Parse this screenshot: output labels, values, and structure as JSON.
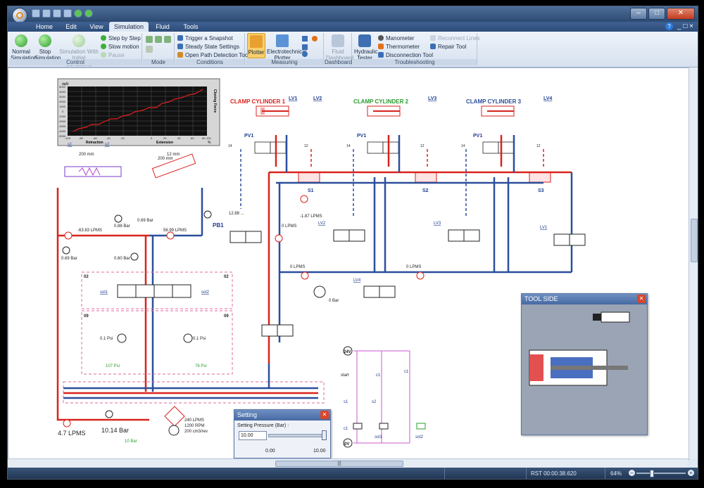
{
  "app": {
    "title": ""
  },
  "tabs": [
    "Home",
    "Edit",
    "View",
    "Simulation",
    "Fluid",
    "Tools"
  ],
  "active_tab": "Simulation",
  "ribbon": {
    "control": {
      "title": "Control",
      "normal_sim": "Normal Simulation",
      "stop_sim": "Stop Simulation",
      "sim_initial": "Simulation With Initial Conditions",
      "step_by_step": "Step by Step",
      "slow_motion": "Slow motion",
      "pause": "Pause"
    },
    "mode": {
      "title": "Mode"
    },
    "conditions": {
      "title": "Conditions",
      "trigger": "Trigger a Snapshot",
      "steady": "Steady State Settings",
      "open_path": "Open Path Detection Tool"
    },
    "measuring": {
      "title": "Measuring",
      "plotter": "Plotter",
      "electro": "Electrotechnical Plotter"
    },
    "dashboard": {
      "title": "Dashboard",
      "fluid": "Fluid Dashboard"
    },
    "troubleshooting": {
      "title": "Troubleshooting",
      "hydraulic": "Hydraulic Tester",
      "manometer": "Manometer",
      "thermometer": "Thermometer",
      "disconnection": "Disconnection Tool",
      "reconnect": "Reconnect Lines",
      "repair": "Repair Tool"
    }
  },
  "plot": {
    "yunit": "daN",
    "ylabel": "Closing Force",
    "left_label": "Retraction",
    "right_label": "Extension",
    "xunit": "%",
    "yticks": [
      "5000",
      "4000",
      "3000",
      "2000",
      "1000",
      "0",
      "-1000",
      "-2000",
      "-3000",
      "-4000",
      "-5000"
    ],
    "xticks": [
      "-100",
      "-80",
      "-60",
      "-40",
      "-20",
      "0",
      "20",
      "40",
      "60",
      "80",
      "100"
    ]
  },
  "circuit": {
    "clamp1": "CLAMP CYLINDER 1",
    "clamp2": "CLAMP CYLINDER 2",
    "clamp3": "CLAMP CYLINDER 3",
    "lv1": "LV1",
    "lv2": "LV2",
    "lv3": "LV3",
    "lv4": "LV4",
    "pv1": "PV1",
    "pb1": "PB1",
    "s1": "S1",
    "s2": "S2",
    "s3": "S3",
    "small_s1": "s1",
    "small_s2": "s2",
    "len_200a": "200 mm",
    "len_12": "12 mm",
    "len_200b": "200 mm",
    "flow_m63": "-63.83 LPMS",
    "flow_56": "56.99 LPMS",
    "flow_m187": "-1.87 LPMS",
    "flow_1288": "12.88 ...",
    "flow_0a": "0 LPMS",
    "flow_0b": "0 LPMS",
    "flow_0c": "0 LPMS",
    "p088": "0.88 Bar",
    "p069a": "0.69 Bar",
    "p069b": "0.69 Bar",
    "p060": "0.60 Bar",
    "p0bar": "0 Bar",
    "p01a": "0.1 Psi",
    "p01b": "0.1 Psi",
    "p107": "107 Psi",
    "p76": "76 Psi",
    "flow_47": "4.7 LPMS",
    "p1014": "10.14 Bar",
    "p10": "10 Bar",
    "pump1": "240 LPMS",
    "pump2": "1200 RPM",
    "pump3": "200 cm3/rev",
    "z02a": "02",
    "z02b": "02",
    "z09a": "09",
    "z09b": "09",
    "sol1": "sol1",
    "sol2": "sol2",
    "n14a": "14",
    "n12a": "12",
    "n14b": "14",
    "n12b": "12",
    "n14c": "14",
    "n12c": "12",
    "v24": "24V",
    "v0": "0V",
    "start": "start",
    "c1": "c1",
    "s1e": "s1",
    "s2e": "s2"
  },
  "tool_side": {
    "title": "TOOL SIDE"
  },
  "setting": {
    "title": "Setting",
    "label": "Setting Pressure (Bar) :",
    "value": "10.00",
    "min": "0.00",
    "max": "10.00",
    "level": 1.0
  },
  "status": {
    "time": "RST 00:00:38.620",
    "zoom": "64%"
  }
}
